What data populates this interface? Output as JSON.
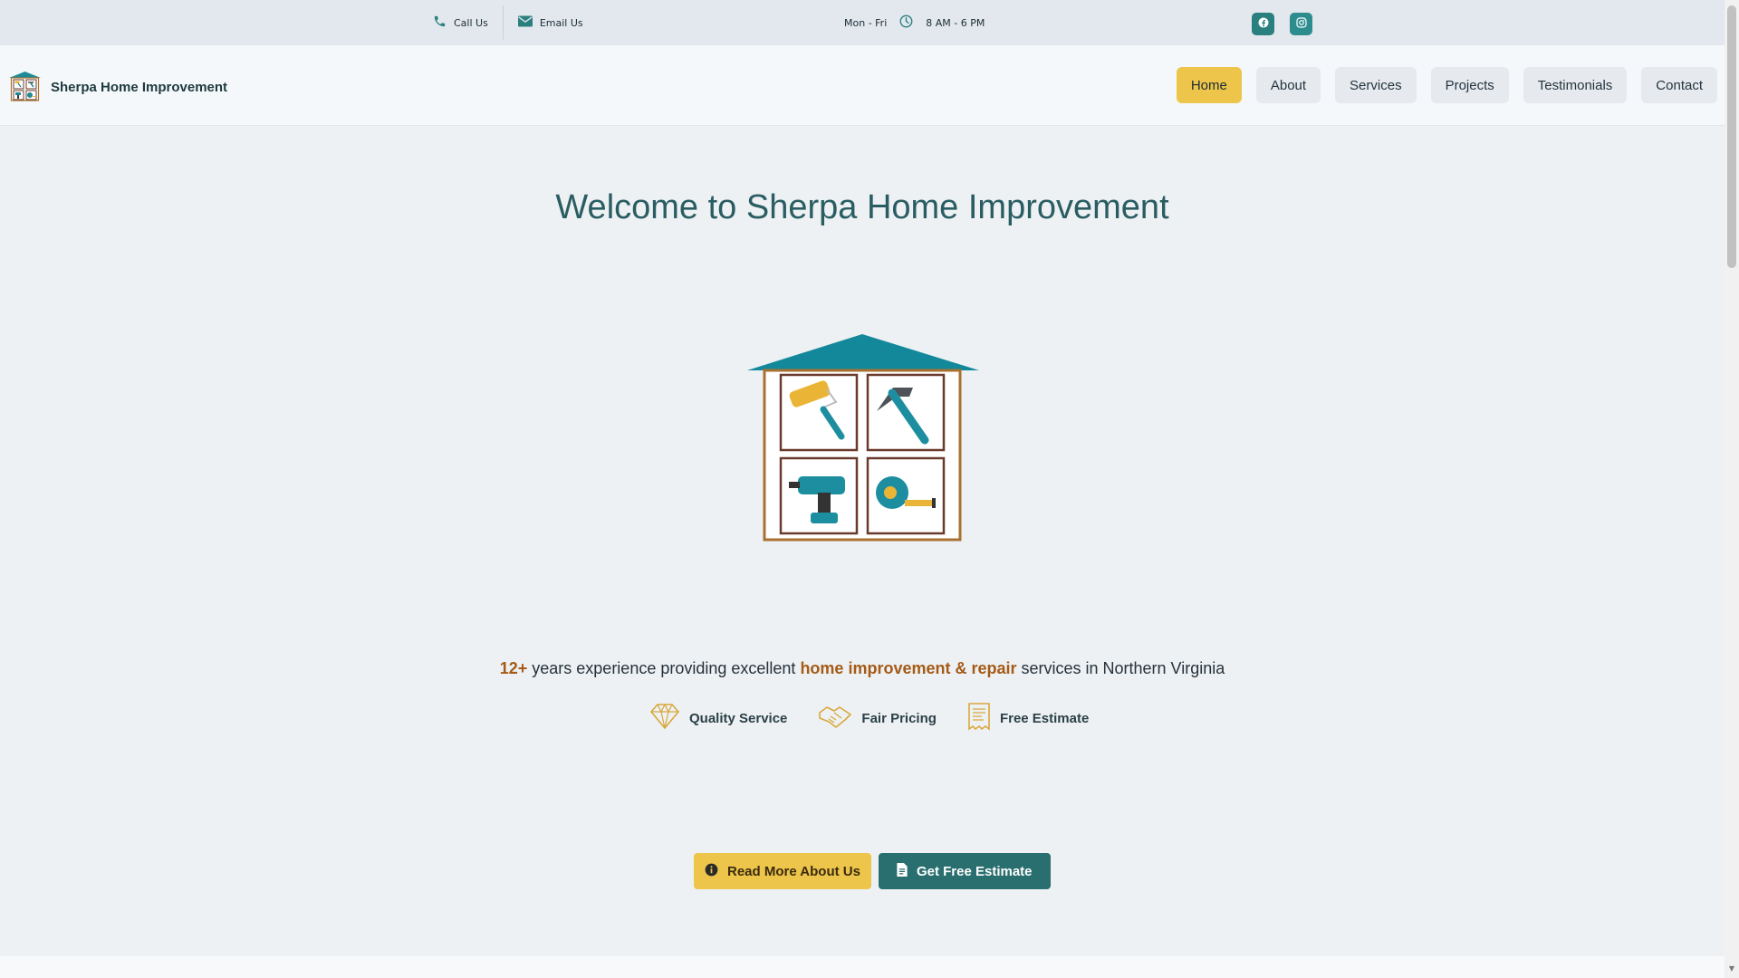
{
  "topbar": {
    "call_label": "Call Us",
    "email_label": "Email Us",
    "days": "Mon - Fri",
    "hours": "8 AM - 6 PM",
    "social": [
      "facebook-icon",
      "instagram-icon"
    ]
  },
  "header": {
    "brand_name": "Sherpa Home Improvement",
    "nav": [
      {
        "label": "Home",
        "active": true
      },
      {
        "label": "About",
        "active": false
      },
      {
        "label": "Services",
        "active": false
      },
      {
        "label": "Projects",
        "active": false
      },
      {
        "label": "Testimonials",
        "active": false
      },
      {
        "label": "Contact",
        "active": false
      }
    ]
  },
  "hero": {
    "title": "Welcome to Sherpa Home Improvement",
    "tagline": {
      "years": "12+",
      "part1": " years experience providing excellent ",
      "highlight": "home improvement & repair",
      "part2": " services in Northern Virginia"
    },
    "features": [
      {
        "icon": "diamond-icon",
        "label": "Quality Service"
      },
      {
        "icon": "handshake-icon",
        "label": "Fair Pricing"
      },
      {
        "icon": "receipt-icon",
        "label": "Free Estimate"
      }
    ],
    "buttons": {
      "read_more": "Read More About Us",
      "estimate": "Get Free Estimate"
    }
  },
  "colors": {
    "accent_yellow": "#ecc54a",
    "accent_teal": "#2a6f6f",
    "title_teal": "#2a5d62",
    "highlight_brown": "#a55a16"
  }
}
